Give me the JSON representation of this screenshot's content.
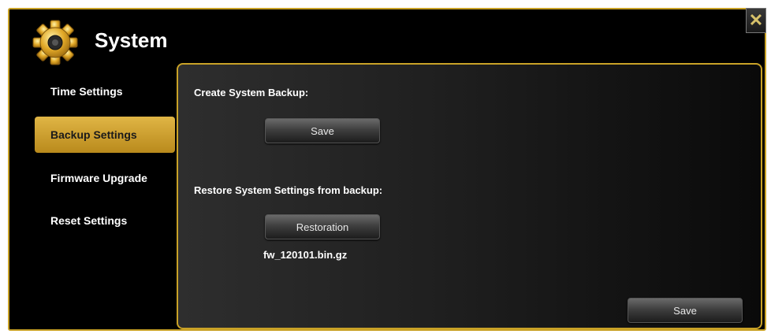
{
  "window": {
    "title": "System",
    "close_glyph": "✕"
  },
  "sidebar": {
    "items": [
      {
        "label": "Time Settings",
        "active": false
      },
      {
        "label": "Backup Settings",
        "active": true
      },
      {
        "label": "Firmware Upgrade",
        "active": false
      },
      {
        "label": "Reset Settings",
        "active": false
      }
    ]
  },
  "main": {
    "backup_label": "Create System Backup:",
    "backup_save_label": "Save",
    "restore_label": "Restore System Settings from backup:",
    "restoration_label": "Restoration",
    "filename": "fw_120101.bin.gz",
    "footer_save_label": "Save"
  },
  "icons": {
    "header": "gear-icon",
    "close": "close-icon"
  },
  "colors": {
    "accent": "#c9a227",
    "active_tab": "#d4a53a",
    "background": "#000000"
  }
}
